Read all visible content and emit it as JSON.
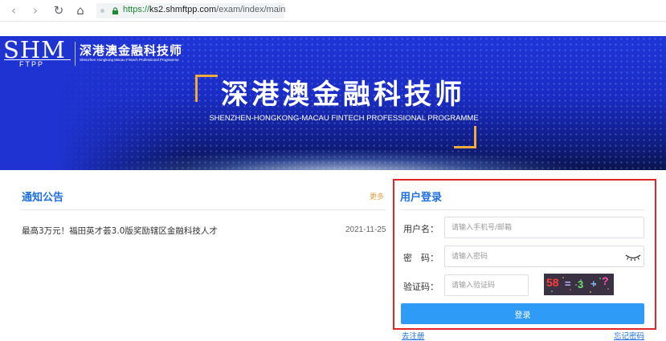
{
  "browser": {
    "back_icon": "‹",
    "forward_icon": "›",
    "reload_icon": "↻",
    "home_icon": "⌂",
    "url_protocol": "https://",
    "url_host": "ks2.shmftpp.com",
    "url_path": "/exam/index/main"
  },
  "banner": {
    "logo_main": "SHM",
    "logo_sub": "FTPP",
    "logo_cn": "深港澳金融科技师",
    "logo_en": "Shenzhen Hongkong Macau Fintech Professional Programme",
    "title": "深港澳金融科技师",
    "subtitle": "SHENZHEN-HONGKONG-MACAU FINTECH PROFESSIONAL PROGRAMME"
  },
  "notice": {
    "title": "通知公告",
    "more": "更多",
    "items": [
      {
        "text": "最高3万元！福田英才荟3.0版奖励辖区金融科技人才",
        "date": "2021-11-25"
      }
    ]
  },
  "login": {
    "title": "用户登录",
    "username_label": "用户名：",
    "username_placeholder": "请输入手机号/邮箱",
    "password_label": "密　码：",
    "password_placeholder": "请输入密码",
    "captcha_label": "验证码：",
    "captcha_placeholder": "请输入验证码",
    "captcha_chars": [
      "58",
      "=",
      "3",
      "+",
      "?"
    ],
    "submit": "登录",
    "register_link": "去注册",
    "forgot_link": "忘记密码"
  },
  "colors": {
    "accent": "#1f6fe0",
    "button": "#2e9bf7",
    "highlight_border": "#e0262c",
    "bracket": "#f0a93a"
  }
}
